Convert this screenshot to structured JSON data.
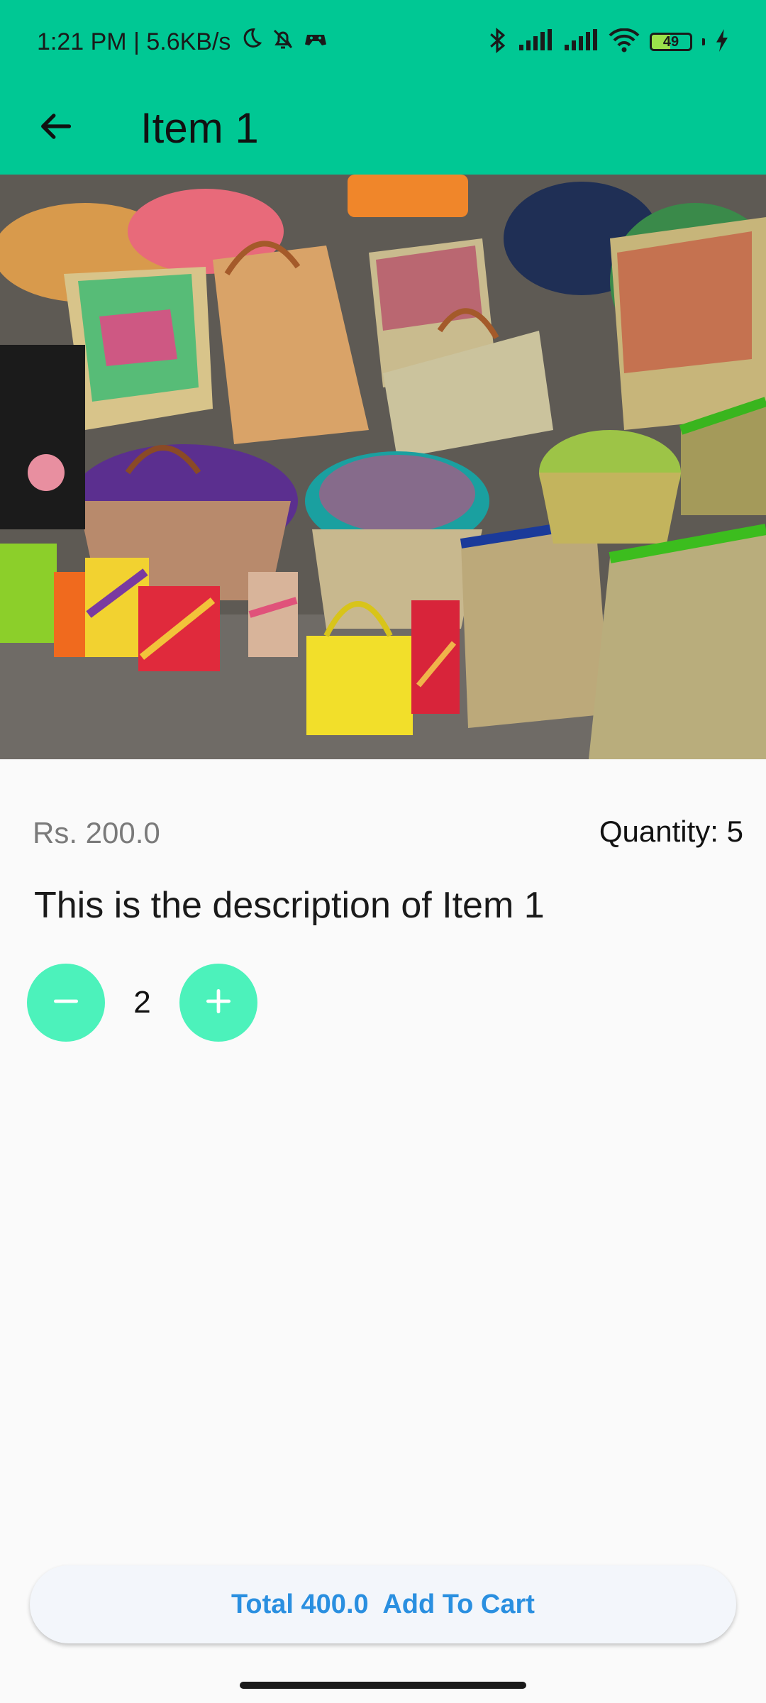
{
  "status_bar": {
    "time_speed": "1:21 PM | 5.6KB/s",
    "battery_level": "49",
    "battery_fraction": 0.49,
    "icons": [
      "moon-icon",
      "bell-off-icon",
      "game-icon",
      "bluetooth-icon",
      "signal-icon",
      "signal-icon",
      "wifi-icon",
      "battery-icon",
      "charging-icon"
    ]
  },
  "app_bar": {
    "title": "Item 1",
    "back_icon": "arrow-left-icon"
  },
  "colors": {
    "primary": "#00c894",
    "button_accent": "#4cf2bb",
    "cta_text": "#2a8fe0",
    "cta_background": "#f3f6fb"
  },
  "product": {
    "image_icon": "woven-baskets-photo",
    "price": "Rs. 200.0",
    "quantity": "Quantity: 5",
    "description": "This is the description of Item 1"
  },
  "stepper": {
    "count": "2",
    "minus_icon": "minus-icon",
    "plus_icon": "plus-icon"
  },
  "cart": {
    "label": "Total 400.0  Add To Cart"
  }
}
